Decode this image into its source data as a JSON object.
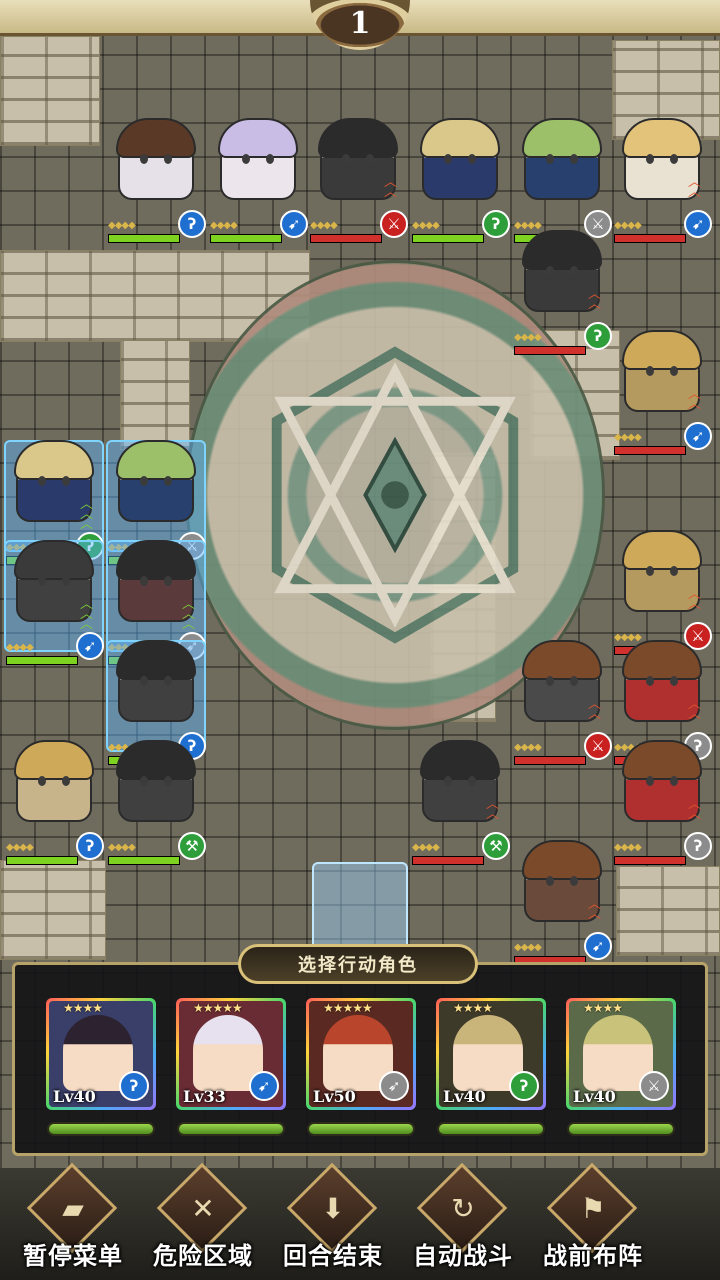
{
  "turn": {
    "number": "1"
  },
  "action_panel": {
    "title": "选择行动角色",
    "characters": [
      {
        "level": "Lv40",
        "stars": "★★★★",
        "weapon": "staff-icon",
        "color": "#1f6fd1",
        "hair": "#2c2230",
        "bg": "#3a3f6a",
        "hp_fraction": 1.0
      },
      {
        "level": "Lv33",
        "stars": "★★★★★",
        "weapon": "spear-icon",
        "color": "#1f6fd1",
        "hair": "#e7e0ee",
        "bg": "#6a2c34",
        "hp_fraction": 1.0
      },
      {
        "level": "Lv50",
        "stars": "★★★★★",
        "weapon": "bow-icon",
        "color": "#8c8c8c",
        "hair": "#b9462c",
        "bg": "#5a2a22",
        "hp_fraction": 1.0
      },
      {
        "level": "Lv40",
        "stars": "★★★★",
        "weapon": "staff-icon",
        "color": "#2d9e3a",
        "hair": "#c9b47a",
        "bg": "#3e3a2a",
        "hp_fraction": 1.0
      },
      {
        "level": "Lv40",
        "stars": "★★★★",
        "weapon": "sword-icon",
        "color": "#8c8c8c",
        "hair": "#c9c27a",
        "bg": "#5b6b4a",
        "hp_fraction": 1.0
      }
    ]
  },
  "menu": [
    {
      "label": "暂停菜单",
      "icon": "book-icon",
      "glyph": "▰"
    },
    {
      "label": "危险区域",
      "icon": "crossed-swords-icon",
      "glyph": "✕"
    },
    {
      "label": "回合结束",
      "icon": "end-turn-arrow-icon",
      "glyph": "⬇"
    },
    {
      "label": "自动战斗",
      "icon": "auto-cycle-icon",
      "glyph": "↻"
    },
    {
      "label": "战前布阵",
      "icon": "formation-flag-icon",
      "glyph": "⚑"
    }
  ],
  "units": [
    {
      "id": "ally-1",
      "team": "ally",
      "weapon": "staff-icon",
      "wcolor": "#1f6fd1",
      "hair": "#5a3a26",
      "coat": "#e6e0e8",
      "hp": 1.0
    },
    {
      "id": "ally-2",
      "team": "ally",
      "weapon": "spear-icon",
      "wcolor": "#1f6fd1",
      "hair": "#c9bde6",
      "coat": "#ece6ec",
      "hp": 1.0
    },
    {
      "id": "enemy-1",
      "team": "enemy",
      "weapon": "sword-icon",
      "wcolor": "#c92020",
      "hair": "#2b2b2b",
      "coat": "#3a3a3a",
      "hp": 1.0
    },
    {
      "id": "ally-3",
      "team": "ally",
      "weapon": "staff-icon",
      "wcolor": "#2d9e3a",
      "hair": "#d9c88a",
      "coat": "#2a3a6a",
      "hp": 1.0
    },
    {
      "id": "ally-4",
      "team": "ally",
      "weapon": "sword-icon",
      "wcolor": "#8c8c8c",
      "hair": "#9cbf6a",
      "coat": "#28406e",
      "hp": 1.0
    },
    {
      "id": "enemy-2",
      "team": "enemy",
      "weapon": "spear-icon",
      "wcolor": "#1f6fd1",
      "hair": "#e3c27a",
      "coat": "#e9e2d2",
      "hp": 1.0
    }
  ],
  "colors": {
    "ally_hp": "#7ed321",
    "enemy_hp": "#d0312d",
    "selection": "#7fd4ff"
  }
}
